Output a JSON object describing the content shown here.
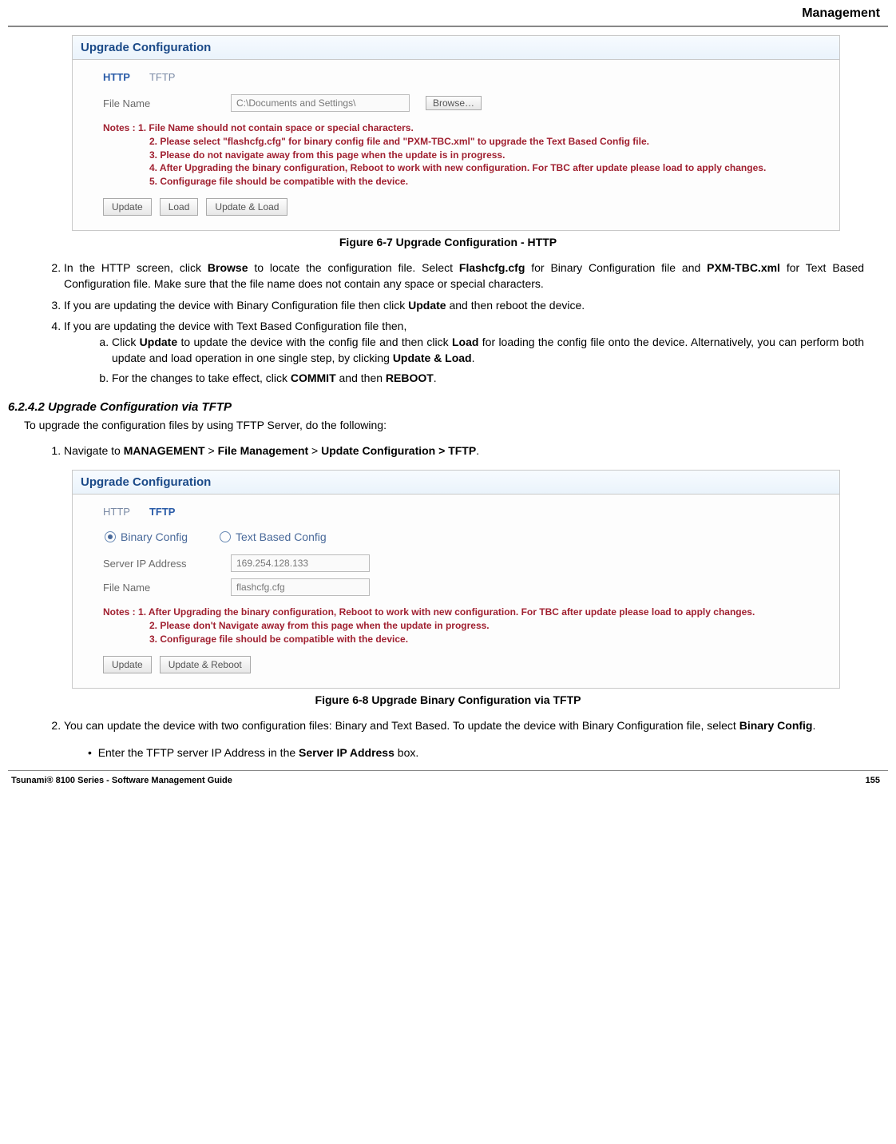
{
  "header": {
    "section": "Management"
  },
  "fig1": {
    "panelTitle": "Upgrade Configuration",
    "tabHttp": "HTTP",
    "tabTftp": "TFTP",
    "fileNameLabel": "File Name",
    "fileNameValue": "C:\\Documents and Settings\\",
    "browseBtn": "Browse…",
    "notesLabel": "Notes :",
    "note1": "1. File Name should not contain space or special characters.",
    "note2": "2. Please select \"flashcfg.cfg\" for binary config file and \"PXM-TBC.xml\" to upgrade the Text Based Config file.",
    "note3": "3. Please do not navigate away from this page when the update is in progress.",
    "note4": "4. After Upgrading the binary configuration, Reboot to work with new configuration. For TBC after update please load to apply changes.",
    "note5": "5. Configurage file should be compatible with the device.",
    "btnUpdate": "Update",
    "btnLoad": "Load",
    "btnUpdateLoad": "Update & Load",
    "caption": "Figure 6-7 Upgrade Configuration - HTTP"
  },
  "body1": {
    "step2_prefix": "In the HTTP screen, click ",
    "step2_browse": "Browse",
    "step2_mid1": " to locate the configuration file. Select ",
    "step2_flash": "Flashcfg.cfg",
    "step2_mid2": " for Binary Configuration file and ",
    "step2_pxm": "PXM-TBC.xml",
    "step2_suffix": " for Text Based Configuration file. Make sure that the file name does not contain any space or special characters.",
    "step3_prefix": "If you are updating the device with Binary Configuration file then click ",
    "step3_update": "Update",
    "step3_suffix": " and then reboot the device.",
    "step4": "If you are updating the device with Text Based Configuration file then,",
    "step4a_prefix": "Click ",
    "step4a_update": "Update",
    "step4a_mid1": " to update the device with the config file and then click ",
    "step4a_load": "Load",
    "step4a_mid2": " for loading the config file onto the device. Alternatively, you can perform both update and load operation in one single step, by clicking ",
    "step4a_updateload": "Update & Load",
    "step4a_suffix": ".",
    "step4b_prefix": "For the changes to take effect, click ",
    "step4b_commit": "COMMIT",
    "step4b_mid": " and then ",
    "step4b_reboot": "REBOOT",
    "step4b_suffix": "."
  },
  "section2": {
    "title": "6.2.4.2 Upgrade Configuration via TFTP",
    "intro": "To upgrade the configuration files by using TFTP Server, do the following:",
    "step1_prefix": "Navigate to ",
    "step1_mgmt": "MANAGEMENT",
    "step1_gt1": " > ",
    "step1_fm": "File Management",
    "step1_gt2": " > ",
    "step1_uc": "Update Configuration > TFTP",
    "step1_suffix": "."
  },
  "fig2": {
    "panelTitle": "Upgrade Configuration",
    "tabHttp": "HTTP",
    "tabTftp": "TFTP",
    "radioBinary": "Binary Config",
    "radioText": "Text Based Config",
    "serverIpLabel": "Server IP Address",
    "serverIpValue": "169.254.128.133",
    "fileNameLabel": "File Name",
    "fileNameValue": "flashcfg.cfg",
    "notesLabel": "Notes :",
    "note1": "1. After Upgrading the binary configuration, Reboot to work with new configuration. For TBC after update please load to apply changes.",
    "note2": "2. Please don't Navigate away from this page when the update in progress.",
    "note3": "3. Configurage file should be compatible with the device.",
    "btnUpdate": "Update",
    "btnUpdateReboot": "Update & Reboot",
    "caption": "Figure 6-8 Upgrade Binary Configuration via TFTP"
  },
  "body2": {
    "step2_prefix": "You can update the device with two configuration files: Binary and Text Based. To update the device with Binary Configuration file, select ",
    "step2_binary": "Binary Config",
    "step2_suffix": ".",
    "bullet_prefix": "Enter the TFTP server IP Address in the ",
    "bullet_bold": "Server IP Address",
    "bullet_suffix": " box."
  },
  "footer": {
    "left": "Tsunami® 8100 Series - Software Management Guide",
    "right": "155"
  }
}
